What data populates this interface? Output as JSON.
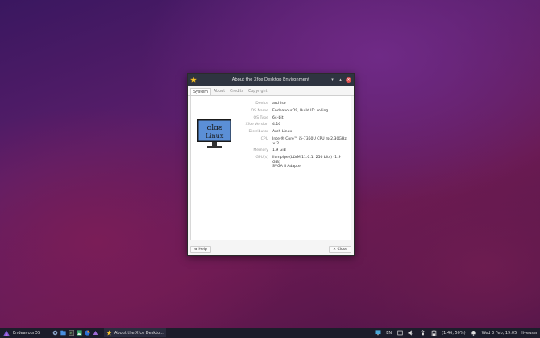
{
  "window": {
    "title": "About the Xfce Desktop Environment",
    "tabs": [
      "System",
      "About",
      "Credits",
      "Copyright"
    ],
    "active_tab": "System",
    "logo_text": [
      "ɑlɑƨ",
      "Linux"
    ],
    "info": [
      {
        "label": "Device",
        "value": "archiso"
      },
      {
        "label": "OS Name",
        "value": "EndeavourOS, Build ID: rolling"
      },
      {
        "label": "OS Type",
        "value": "64-bit"
      },
      {
        "label": "Xfce Version",
        "value": "4.16"
      },
      {
        "label": "Distributor",
        "value": "Arch Linux"
      },
      {
        "label": "CPU",
        "value": "Intel® Core™ i5-7360U CPU @ 2.30GHz × 2"
      },
      {
        "label": "Memory",
        "value": "1.9 GiB"
      },
      {
        "label": "GPU(s)",
        "value": "llvmpipe (LLVM 11.0.1, 256 bits) (1.9 GiB)"
      }
    ],
    "gpu_extra": "SVGA II Adapter",
    "help_label": "Help",
    "close_label": "Close"
  },
  "taskbar": {
    "start_label": "EndeavourOS",
    "task_label": "About the Xfce Deskto...",
    "lang": "EN",
    "battery": "(1:46, 50%)",
    "clock": "Wed 3 Feb, 19:05",
    "user": "liveuser"
  },
  "colors": {
    "taskbar_bg": "#1c1d2b",
    "titlebar_bg": "#2e3440",
    "close_red": "#e05050",
    "logo_blue": "#5b8fd6"
  }
}
